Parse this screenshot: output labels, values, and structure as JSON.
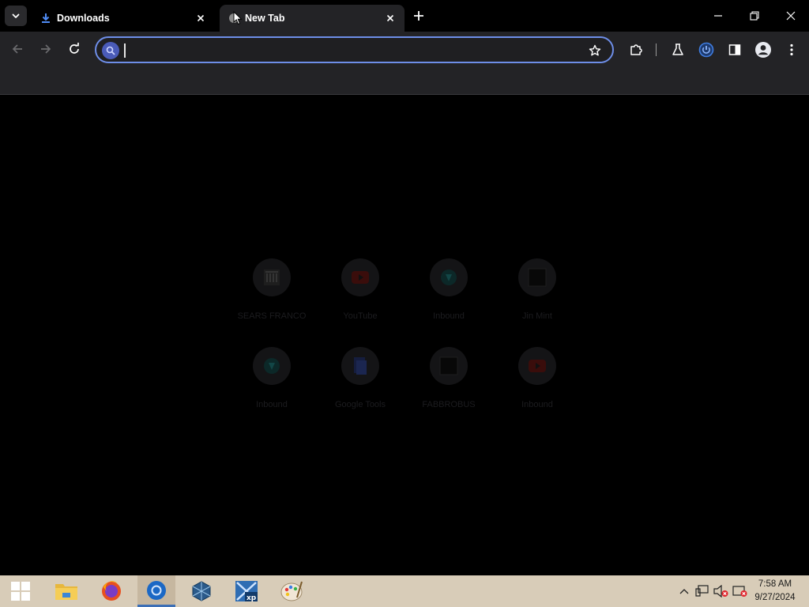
{
  "browser": {
    "tabs": [
      {
        "title": "Downloads",
        "favicon": "download-icon",
        "active": false
      },
      {
        "title": "New Tab",
        "favicon": "new-tab-icon",
        "active": true
      }
    ],
    "omnibox": {
      "value": "",
      "placeholder": ""
    }
  },
  "shortcuts": [
    {
      "label": "SEARS FRANCO",
      "icon": "building-icon",
      "color": "#e8e8e8"
    },
    {
      "label": "YouTube",
      "icon": "youtube-icon",
      "color": "#e62117"
    },
    {
      "label": "Inbound",
      "icon": "teal-shield-icon",
      "color": "#16a3a3"
    },
    {
      "label": "Jin Mint",
      "icon": "dark-square-icon",
      "color": "#222"
    },
    {
      "label": "Inbound",
      "icon": "teal-shield-icon",
      "color": "#16a3a3"
    },
    {
      "label": "Google Tools",
      "icon": "doc-icon",
      "color": "#3b5ed4"
    },
    {
      "label": "FABBROBUS",
      "icon": "dark-square-icon",
      "color": "#222"
    },
    {
      "label": "Inbound",
      "icon": "youtube-icon",
      "color": "#e62117"
    }
  ],
  "taskbar": {
    "clock_time": "7:58 AM",
    "clock_date": "9/27/2024"
  }
}
